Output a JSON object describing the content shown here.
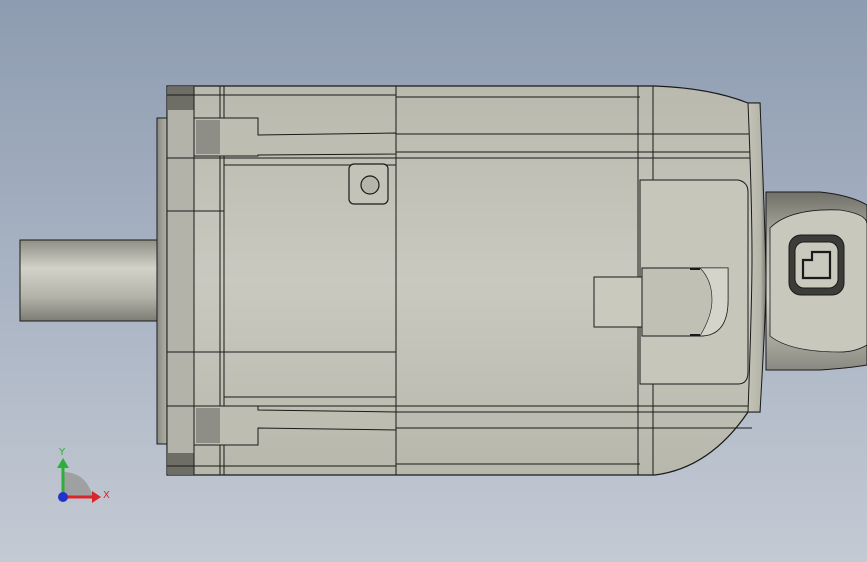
{
  "triad": {
    "x_label": "X",
    "y_label": "Y",
    "x_color": "#d8262b",
    "y_color": "#2fae3a",
    "z_color": "#2233cc"
  },
  "colors": {
    "background_top": "#8e9cb1",
    "background_bottom": "#c4cad4",
    "part_body": "#c7c7bc",
    "part_edge": "#1a1a1a"
  }
}
